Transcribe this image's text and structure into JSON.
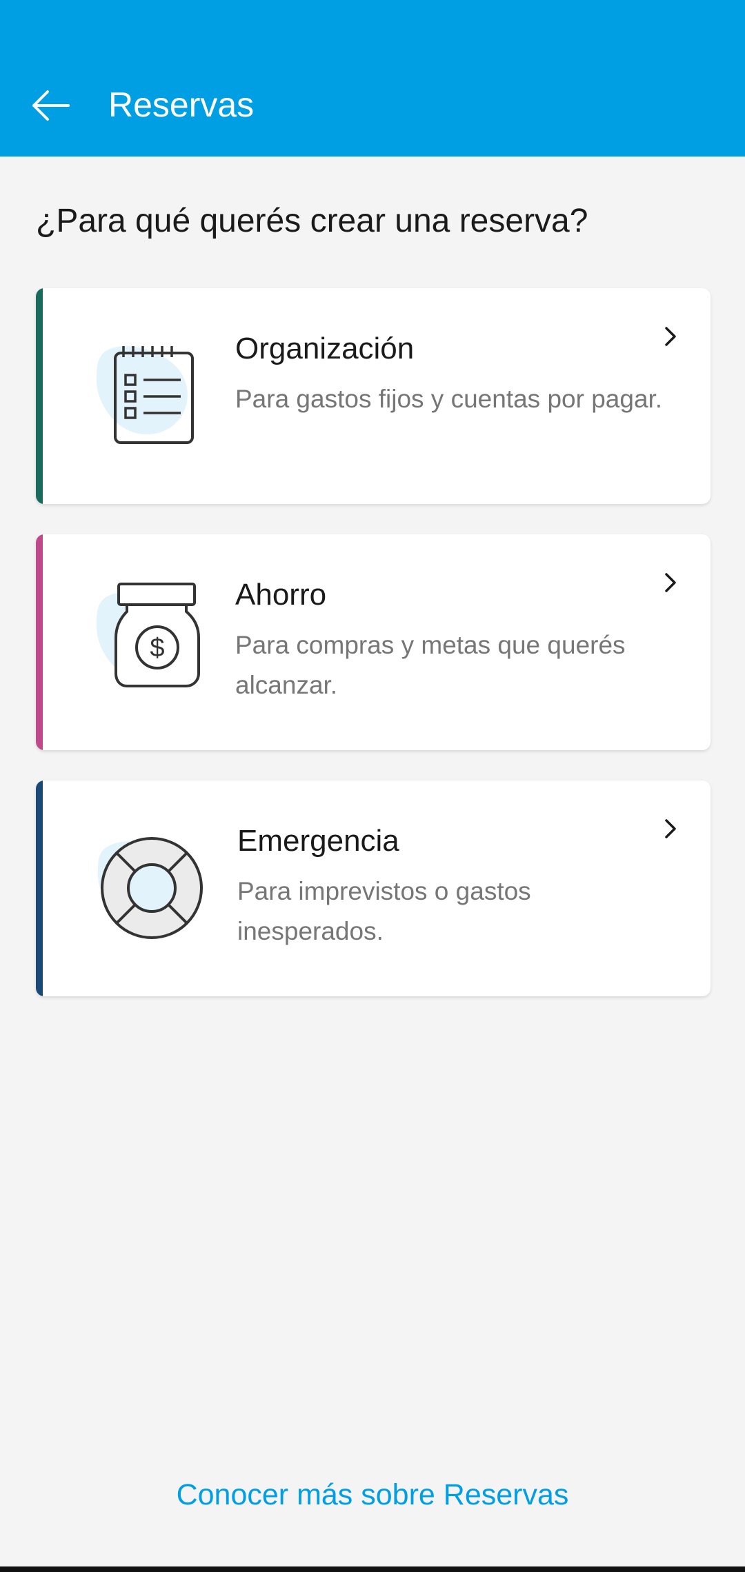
{
  "header": {
    "title": "Reservas",
    "back_icon": "arrow-left-icon"
  },
  "question": "¿Para qué querés crear una reserva?",
  "options": [
    {
      "title": "Organización",
      "description": "Para gastos fijos y cuentas por pagar.",
      "icon": "notepad-checklist-icon",
      "accent_color": "#1a6a5e"
    },
    {
      "title": "Ahorro",
      "description": "Para compras y metas que querés alcanzar.",
      "icon": "money-jar-icon",
      "accent_color": "#c0498b"
    },
    {
      "title": "Emergencia",
      "description": "Para imprevistos o gastos inesperados.",
      "icon": "lifebuoy-icon",
      "accent_color": "#1b4978"
    }
  ],
  "footer": {
    "link_label": "Conocer más sobre Reservas"
  },
  "colors": {
    "brand": "#009ee3",
    "background": "#f4f4f4"
  }
}
